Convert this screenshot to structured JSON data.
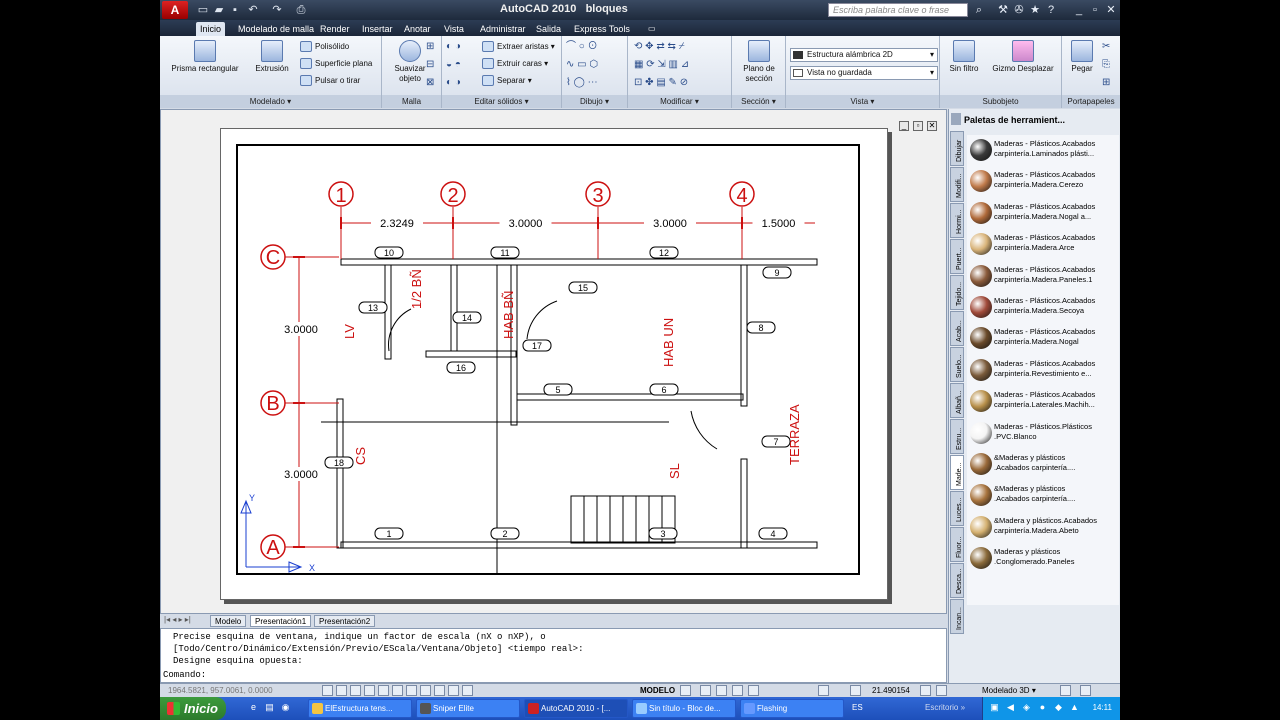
{
  "app": {
    "title": "AutoCAD 2010",
    "document": "bloques",
    "logo_text": "A",
    "search_placeholder": "Escriba palabra clave o frase"
  },
  "ribbon_tabs": [
    {
      "label": "Inicio",
      "active": true
    },
    {
      "label": "Modelado de malla"
    },
    {
      "label": "Render"
    },
    {
      "label": "Insertar"
    },
    {
      "label": "Anotar"
    },
    {
      "label": "Vista"
    },
    {
      "label": "Administrar"
    },
    {
      "label": "Salida"
    },
    {
      "label": "Express Tools"
    }
  ],
  "ribbon": {
    "modelado": {
      "label": "Modelado",
      "prisma": "Prisma rectangular",
      "extrusion": "Extrusión",
      "polisolido": "Polisólido",
      "superficie": "Superficie plana",
      "pulsar": "Pulsar o tirar"
    },
    "malla": {
      "label": "Malla",
      "suavizar": "Suavizar objeto"
    },
    "editar": {
      "label": "Editar sólidos",
      "extraer": "Extraer aristas",
      "extruir": "Extruir caras",
      "separar": "Separar"
    },
    "dibujo": {
      "label": "Dibujo"
    },
    "modificar": {
      "label": "Modificar"
    },
    "seccion": {
      "label": "Sección",
      "plano": "Plano de sección"
    },
    "vista": {
      "label": "Vista",
      "visual_style": "Estructura alámbrica 2D",
      "saved_view": "Vista no guardada"
    },
    "subobjeto": {
      "label": "Subobjeto",
      "sin_filtro": "Sin filtro",
      "gizmo": "Gizmo Desplazar"
    },
    "portapapeles": {
      "label": "Portapapeles",
      "pegar": "Pegar"
    }
  },
  "drawing": {
    "columns": [
      "1",
      "2",
      "3",
      "4"
    ],
    "rows": [
      "C",
      "B",
      "A"
    ],
    "x_dims": [
      "2.3249",
      "3.0000",
      "3.0000",
      "1.5000"
    ],
    "y_dims": [
      "3.0000",
      "3.0000"
    ],
    "rooms": {
      "lv": "LV",
      "half_bath": "1/2 BÑ",
      "hab_bn": "HAB BÑ",
      "hab_un": "HAB UN",
      "cs": "CS",
      "sl": "SL",
      "terraza": "TERRAZA"
    },
    "tags": [
      "1",
      "2",
      "3",
      "4",
      "5",
      "6",
      "7",
      "8",
      "9",
      "10",
      "11",
      "12",
      "13",
      "14",
      "15",
      "16",
      "17",
      "18"
    ],
    "axis_y": "Y",
    "axis_x": "X"
  },
  "layout_tabs": [
    {
      "label": "Modelo"
    },
    {
      "label": "Presentación1",
      "active": true
    },
    {
      "label": "Presentación2"
    }
  ],
  "command": {
    "lines": [
      "Precise esquina de ventana, indique un factor de escala (nX o nXP), o",
      "[Todo/Centro/Dinámico/Extensión/Previo/EScala/Ventana/Objeto] <tiempo real>:",
      "Designe esquina opuesta:"
    ],
    "prompt": "Comando:"
  },
  "status": {
    "coords": "1964.5821, 957.0061, 0.0000",
    "model": "MODELO",
    "scale": "21.490154",
    "workspace": "Modelado 3D"
  },
  "palette": {
    "title": "Paletas de herramient...",
    "vtabs": [
      "Dibujar",
      "Modifi...",
      "Hormi...",
      "Puert...",
      "Tejido...",
      "Acab...",
      "Suelo...",
      "Albañ...",
      "Estru...",
      "Made...",
      "Luces...",
      "Fluor...",
      "Desca...",
      "Incan..."
    ],
    "items": [
      {
        "line1": "Maderas - Plásticos.Acabados",
        "line2": "carpintería.Laminados plásti...",
        "color": "#3a3a3a"
      },
      {
        "line1": "Maderas - Plásticos.Acabados",
        "line2": "carpintería.Madera.Cerezo",
        "color": "#c07a4a"
      },
      {
        "line1": "Maderas - Plásticos.Acabados",
        "line2": "carpintería.Madera.Nogal a...",
        "color": "#b06a3a"
      },
      {
        "line1": "Maderas - Plásticos.Acabados",
        "line2": "carpintería.Madera.Arce",
        "color": "#d9b47a"
      },
      {
        "line1": "Maderas - Plásticos.Acabados",
        "line2": "carpintería.Madera.Paneles.1",
        "color": "#8a5a3a"
      },
      {
        "line1": "Maderas - Plásticos.Acabados",
        "line2": "carpintería.Madera.Secoya",
        "color": "#a04a3a"
      },
      {
        "line1": "Maderas - Plásticos.Acabados",
        "line2": "carpintería.Madera.Nogal",
        "color": "#6a4a2a"
      },
      {
        "line1": "Maderas - Plásticos.Acabados",
        "line2": "carpintería.Revestimiento e...",
        "color": "#7a5a3a"
      },
      {
        "line1": "Maderas - Plásticos.Acabados",
        "line2": "carpintería.Laterales.Machih...",
        "color": "#b8904a"
      },
      {
        "line1": "Maderas - Plásticos.Plásticos",
        "line2": ".PVC.Blanco",
        "color": "#f4f4f4"
      },
      {
        "line1": "&Maderas y plásticos",
        "line2": ".Acabados carpintería....",
        "color": "#9a6a3a"
      },
      {
        "line1": "&Maderas y plásticos",
        "line2": ".Acabados carpintería....",
        "color": "#a8743e"
      },
      {
        "line1": "&Madera y plásticos.Acabados",
        "line2": "carpintería.Madera.Abeto",
        "color": "#d4b070"
      },
      {
        "line1": "Maderas y plásticos",
        "line2": ".Conglomerado.Paneles",
        "color": "#8a6a3a"
      }
    ]
  },
  "taskbar": {
    "start": "Inicio",
    "tasks": [
      {
        "label": "ElEstructura tens..."
      },
      {
        "label": "Sniper Elite"
      },
      {
        "label": "AutoCAD 2010 - [...",
        "active": true
      },
      {
        "label": "Sin título - Bloc de..."
      },
      {
        "label": "Flashing"
      }
    ],
    "lang": "ES",
    "desktop": "Escritorio",
    "clock": "14:11"
  }
}
